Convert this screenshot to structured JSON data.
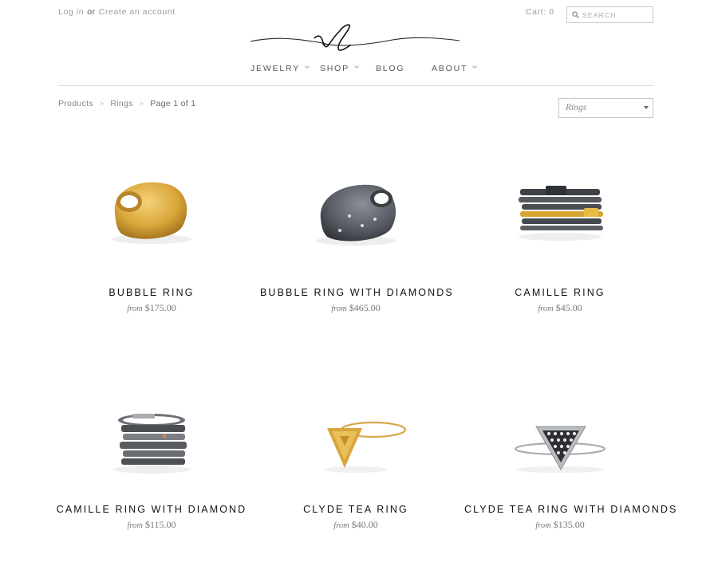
{
  "header": {
    "login_label": "Log in",
    "or_label": "or",
    "create_account_label": "Create an account",
    "cart_label": "Cart: 0",
    "search_placeholder": "SEARCH"
  },
  "nav": {
    "items": [
      {
        "label": "JEWELRY",
        "has_dropdown": true
      },
      {
        "label": "SHOP",
        "has_dropdown": true
      },
      {
        "label": "BLOG",
        "has_dropdown": false
      },
      {
        "label": "ABOUT",
        "has_dropdown": true
      }
    ]
  },
  "breadcrumb": {
    "items": [
      "Products",
      "Rings",
      "Page 1 of 1"
    ],
    "separator": ">"
  },
  "filter": {
    "selected": "Rings"
  },
  "products": [
    {
      "name": "BUBBLE RING",
      "from_label": "from",
      "price": "$175.00"
    },
    {
      "name": "BUBBLE RING WITH DIAMONDS",
      "from_label": "from",
      "price": "$465.00"
    },
    {
      "name": "CAMILLE RING",
      "from_label": "from",
      "price": "$45.00"
    },
    {
      "name": "CAMILLE RING WITH DIAMOND",
      "from_label": "from",
      "price": "$115.00"
    },
    {
      "name": "CLYDE TEA RING",
      "from_label": "from",
      "price": "$40.00"
    },
    {
      "name": "CLYDE TEA RING WITH DIAMONDS",
      "from_label": "from",
      "price": "$135.00"
    }
  ],
  "colors": {
    "gold": "#d9a93a",
    "oxidized_silver": "#5a5e66",
    "silver": "#b9bcc0",
    "text_dark": "#111111",
    "text_muted": "#9a9a9a"
  }
}
